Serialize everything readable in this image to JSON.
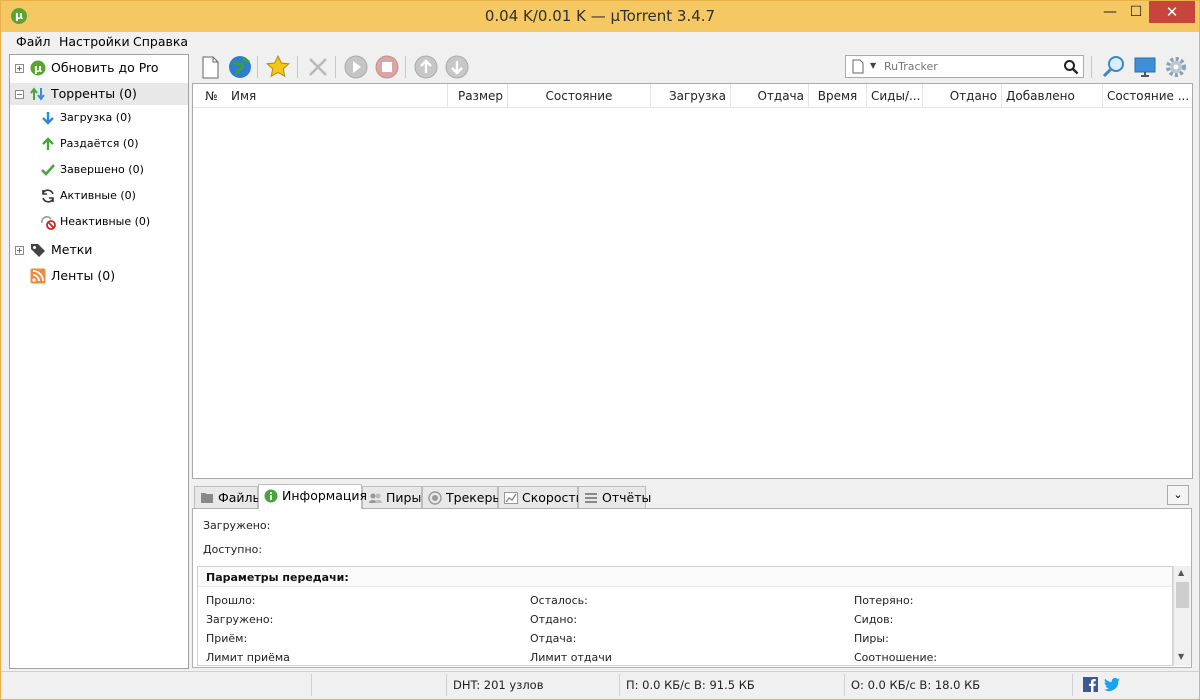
{
  "window": {
    "title": "0.04 K/0.01 K — µTorrent 3.4.7",
    "app_icon": "utorrent-icon",
    "controls": {
      "minimize": "—",
      "maximize": "☐",
      "close": "✕"
    }
  },
  "menu": [
    "Файл",
    "Настройки",
    "Справка"
  ],
  "sidebar": {
    "items": [
      {
        "label": "Обновить до Pro",
        "icon": "utorrent-pro-icon",
        "level": "top",
        "expander": "+"
      },
      {
        "label": "Торренты (0)",
        "icon": "torrents-icon",
        "level": "top",
        "expander": "−"
      },
      {
        "label": "Загрузка (0)",
        "icon": "download-arrow-icon",
        "level": "sub"
      },
      {
        "label": "Раздаётся (0)",
        "icon": "upload-arrow-icon",
        "level": "sub"
      },
      {
        "label": "Завершено (0)",
        "icon": "checkmark-icon",
        "level": "sub"
      },
      {
        "label": "Активные (0)",
        "icon": "refresh-icon",
        "level": "sub"
      },
      {
        "label": "Неактивные (0)",
        "icon": "inactive-icon",
        "level": "sub"
      },
      {
        "label": "Метки",
        "icon": "tag-icon",
        "level": "top",
        "expander": "+"
      },
      {
        "label": "Ленты (0)",
        "icon": "rss-icon",
        "level": "top"
      }
    ]
  },
  "toolbar": {
    "buttons": [
      {
        "name": "add-torrent-button",
        "icon": "new-document-icon"
      },
      {
        "name": "add-url-button",
        "icon": "globe-icon"
      },
      {
        "name": "create-torrent-button",
        "icon": "star-icon"
      },
      {
        "name": "remove-button",
        "icon": "delete-x-icon"
      },
      {
        "name": "start-button",
        "icon": "play-icon"
      },
      {
        "name": "stop-button",
        "icon": "stop-icon"
      },
      {
        "name": "move-up-button",
        "icon": "arrow-up-icon"
      },
      {
        "name": "move-down-button",
        "icon": "arrow-down-icon"
      },
      {
        "name": "find-button",
        "icon": "magnifier-icon"
      },
      {
        "name": "remote-button",
        "icon": "monitor-icon"
      },
      {
        "name": "settings-button",
        "icon": "gear-icon"
      }
    ],
    "search": {
      "placeholder": "RuTracker",
      "value": ""
    }
  },
  "torrent_list": {
    "columns": [
      "№",
      "Имя",
      "Размер",
      "Состояние",
      "Загрузка",
      "Отдача",
      "Время",
      "Сиды/...",
      "Отдано",
      "Добавлено",
      "Состояние ..."
    ],
    "rows": []
  },
  "detail_tabs": {
    "tabs": [
      {
        "label": "Файлы",
        "icon": "files-icon"
      },
      {
        "label": "Информация",
        "icon": "info-icon",
        "active": true
      },
      {
        "label": "Пиры",
        "icon": "peers-icon"
      },
      {
        "label": "Трекеры",
        "icon": "trackers-icon"
      },
      {
        "label": "Скорость",
        "icon": "speed-graph-icon"
      },
      {
        "label": "Отчёты",
        "icon": "log-icon"
      }
    ],
    "collapse_glyph": "⌄"
  },
  "info": {
    "downloaded_label": "Загружено:",
    "available_label": "Доступно:",
    "transfer": {
      "title": "Параметры передачи:",
      "col1": [
        "Прошло:",
        "Загружено:",
        "Приём:",
        "Лимит приёма"
      ],
      "col2": [
        "Осталось:",
        "Отдано:",
        "Отдача:",
        "Лимит отдачи"
      ],
      "col3": [
        "Потеряно:",
        "Сидов:",
        "Пиры:",
        "Соотношение:"
      ]
    }
  },
  "statusbar": {
    "dht": "DHT: 201 узлов",
    "download": "П: 0.0 КБ/с В: 91.5 КБ",
    "upload": "О: 0.0 КБ/с В: 18.0 КБ",
    "social": [
      "facebook-icon",
      "twitter-icon"
    ]
  },
  "colors": {
    "titlebar": "#f5c863",
    "close": "#c7453a",
    "accent_green": "#5aa531"
  }
}
